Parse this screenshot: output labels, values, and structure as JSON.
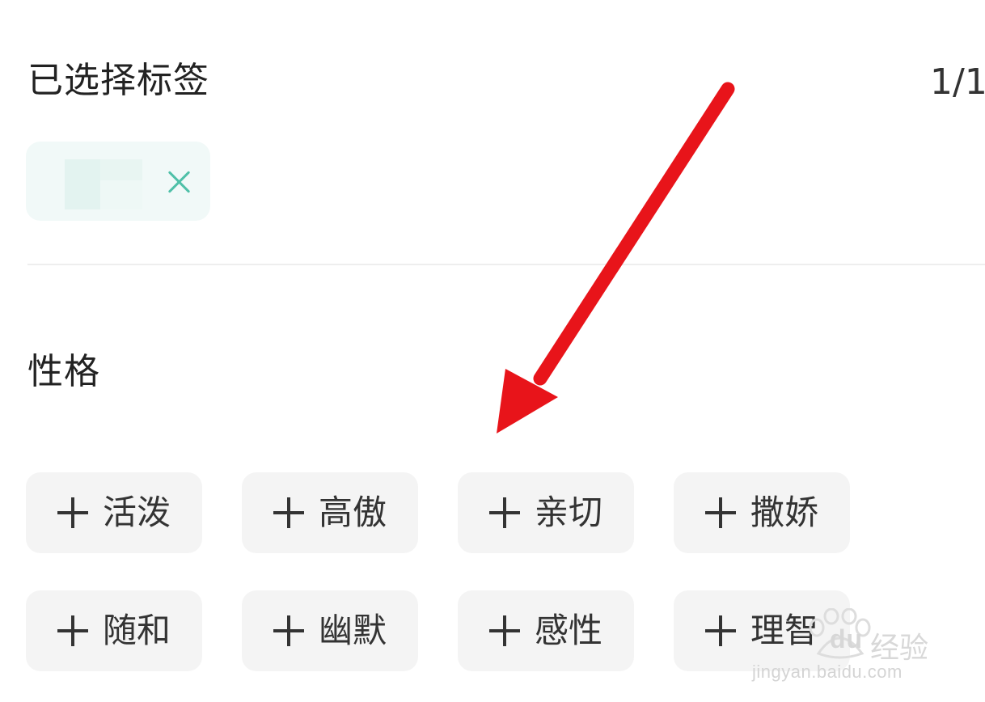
{
  "selected_section": {
    "title": "已选择标签",
    "count": "1/1",
    "chip": {
      "label": "",
      "remove_icon": "close-icon"
    }
  },
  "personality_section": {
    "title": "性格",
    "tags": [
      {
        "label": "活泼",
        "icon": "plus-icon"
      },
      {
        "label": "高傲",
        "icon": "plus-icon"
      },
      {
        "label": "亲切",
        "icon": "plus-icon"
      },
      {
        "label": "撒娇",
        "icon": "plus-icon"
      },
      {
        "label": "随和",
        "icon": "plus-icon"
      },
      {
        "label": "幽默",
        "icon": "plus-icon"
      },
      {
        "label": "感性",
        "icon": "plus-icon"
      },
      {
        "label": "理智",
        "icon": "plus-icon"
      }
    ]
  },
  "watermark": {
    "logo": "du",
    "text": "经验",
    "url": "jingyan.baidu.com"
  },
  "colors": {
    "accent": "#4fc0a8",
    "chip_background": "#f1f9f8",
    "tag_background": "#f4f4f4",
    "annotation_arrow": "#e8141a"
  }
}
